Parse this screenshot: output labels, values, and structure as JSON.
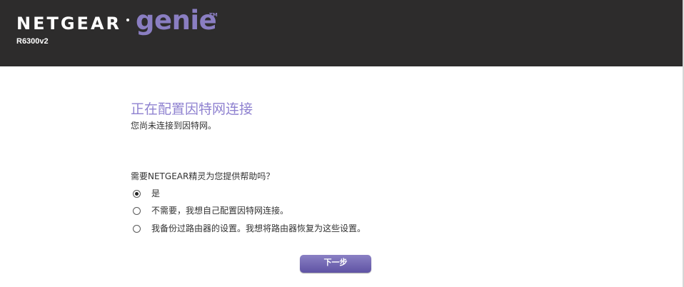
{
  "header": {
    "brand": "NETGEAR",
    "product": "genie",
    "trademark": "TM",
    "model": "R6300v2"
  },
  "main": {
    "title": "正在配置因特网连接",
    "subtitle": "您尚未连接到因特网。",
    "question": "需要NETGEAR精灵为您提供帮助吗？",
    "options": [
      {
        "label": "是",
        "selected": true
      },
      {
        "label": "不需要，我想自己配置因特网连接。",
        "selected": false
      },
      {
        "label": "我备份过路由器的设置。我想将路由器恢复为这些设置。",
        "selected": false
      }
    ],
    "next_label": "下一步"
  },
  "colors": {
    "header_bg": "#2d2c2c",
    "accent": "#8a7ec2",
    "button_top": "#8a80c4",
    "button_bottom": "#5f53a4"
  }
}
